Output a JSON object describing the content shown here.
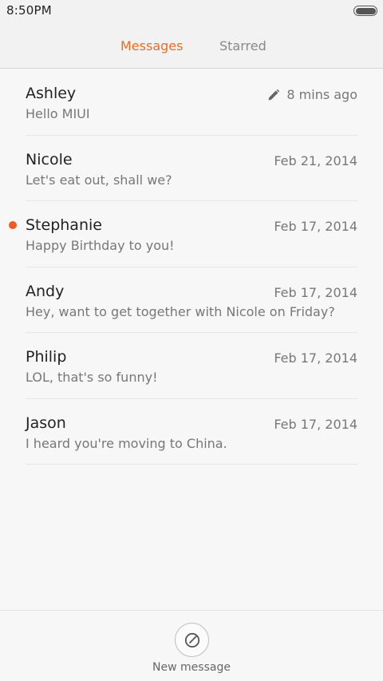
{
  "status_bar": {
    "time": "8:50PM",
    "battery_icon": "battery-icon"
  },
  "tabs": [
    {
      "label": "Messages",
      "active": true
    },
    {
      "label": "Starred",
      "active": false
    }
  ],
  "colors": {
    "accent": "#ea6c23",
    "unread_dot": "#f05a22",
    "background": "#f7f7f7",
    "header_background": "#f2f2f2"
  },
  "messages": [
    {
      "name": "Ashley",
      "preview": "Hello MIUI",
      "time": "8 mins ago",
      "draft_icon": "pencil-icon",
      "unread": false
    },
    {
      "name": "Nicole",
      "preview": "Let's eat out, shall we?",
      "time": "Feb 21, 2014",
      "unread": false
    },
    {
      "name": "Stephanie",
      "preview": "Happy Birthday to you!",
      "time": "Feb 17, 2014",
      "unread": true
    },
    {
      "name": "Andy",
      "preview": "Hey, want to get together with Nicole on Friday?",
      "time": "Feb 17, 2014",
      "unread": false
    },
    {
      "name": "Philip",
      "preview": "LOL, that's so funny!",
      "time": "Feb 17, 2014",
      "unread": false
    },
    {
      "name": "Jason",
      "preview": "I heard you're moving to China.",
      "time": "Feb 17, 2014",
      "unread": false
    }
  ],
  "bottom_bar": {
    "new_message_label": "New message",
    "compose_icon": "compose-icon"
  }
}
